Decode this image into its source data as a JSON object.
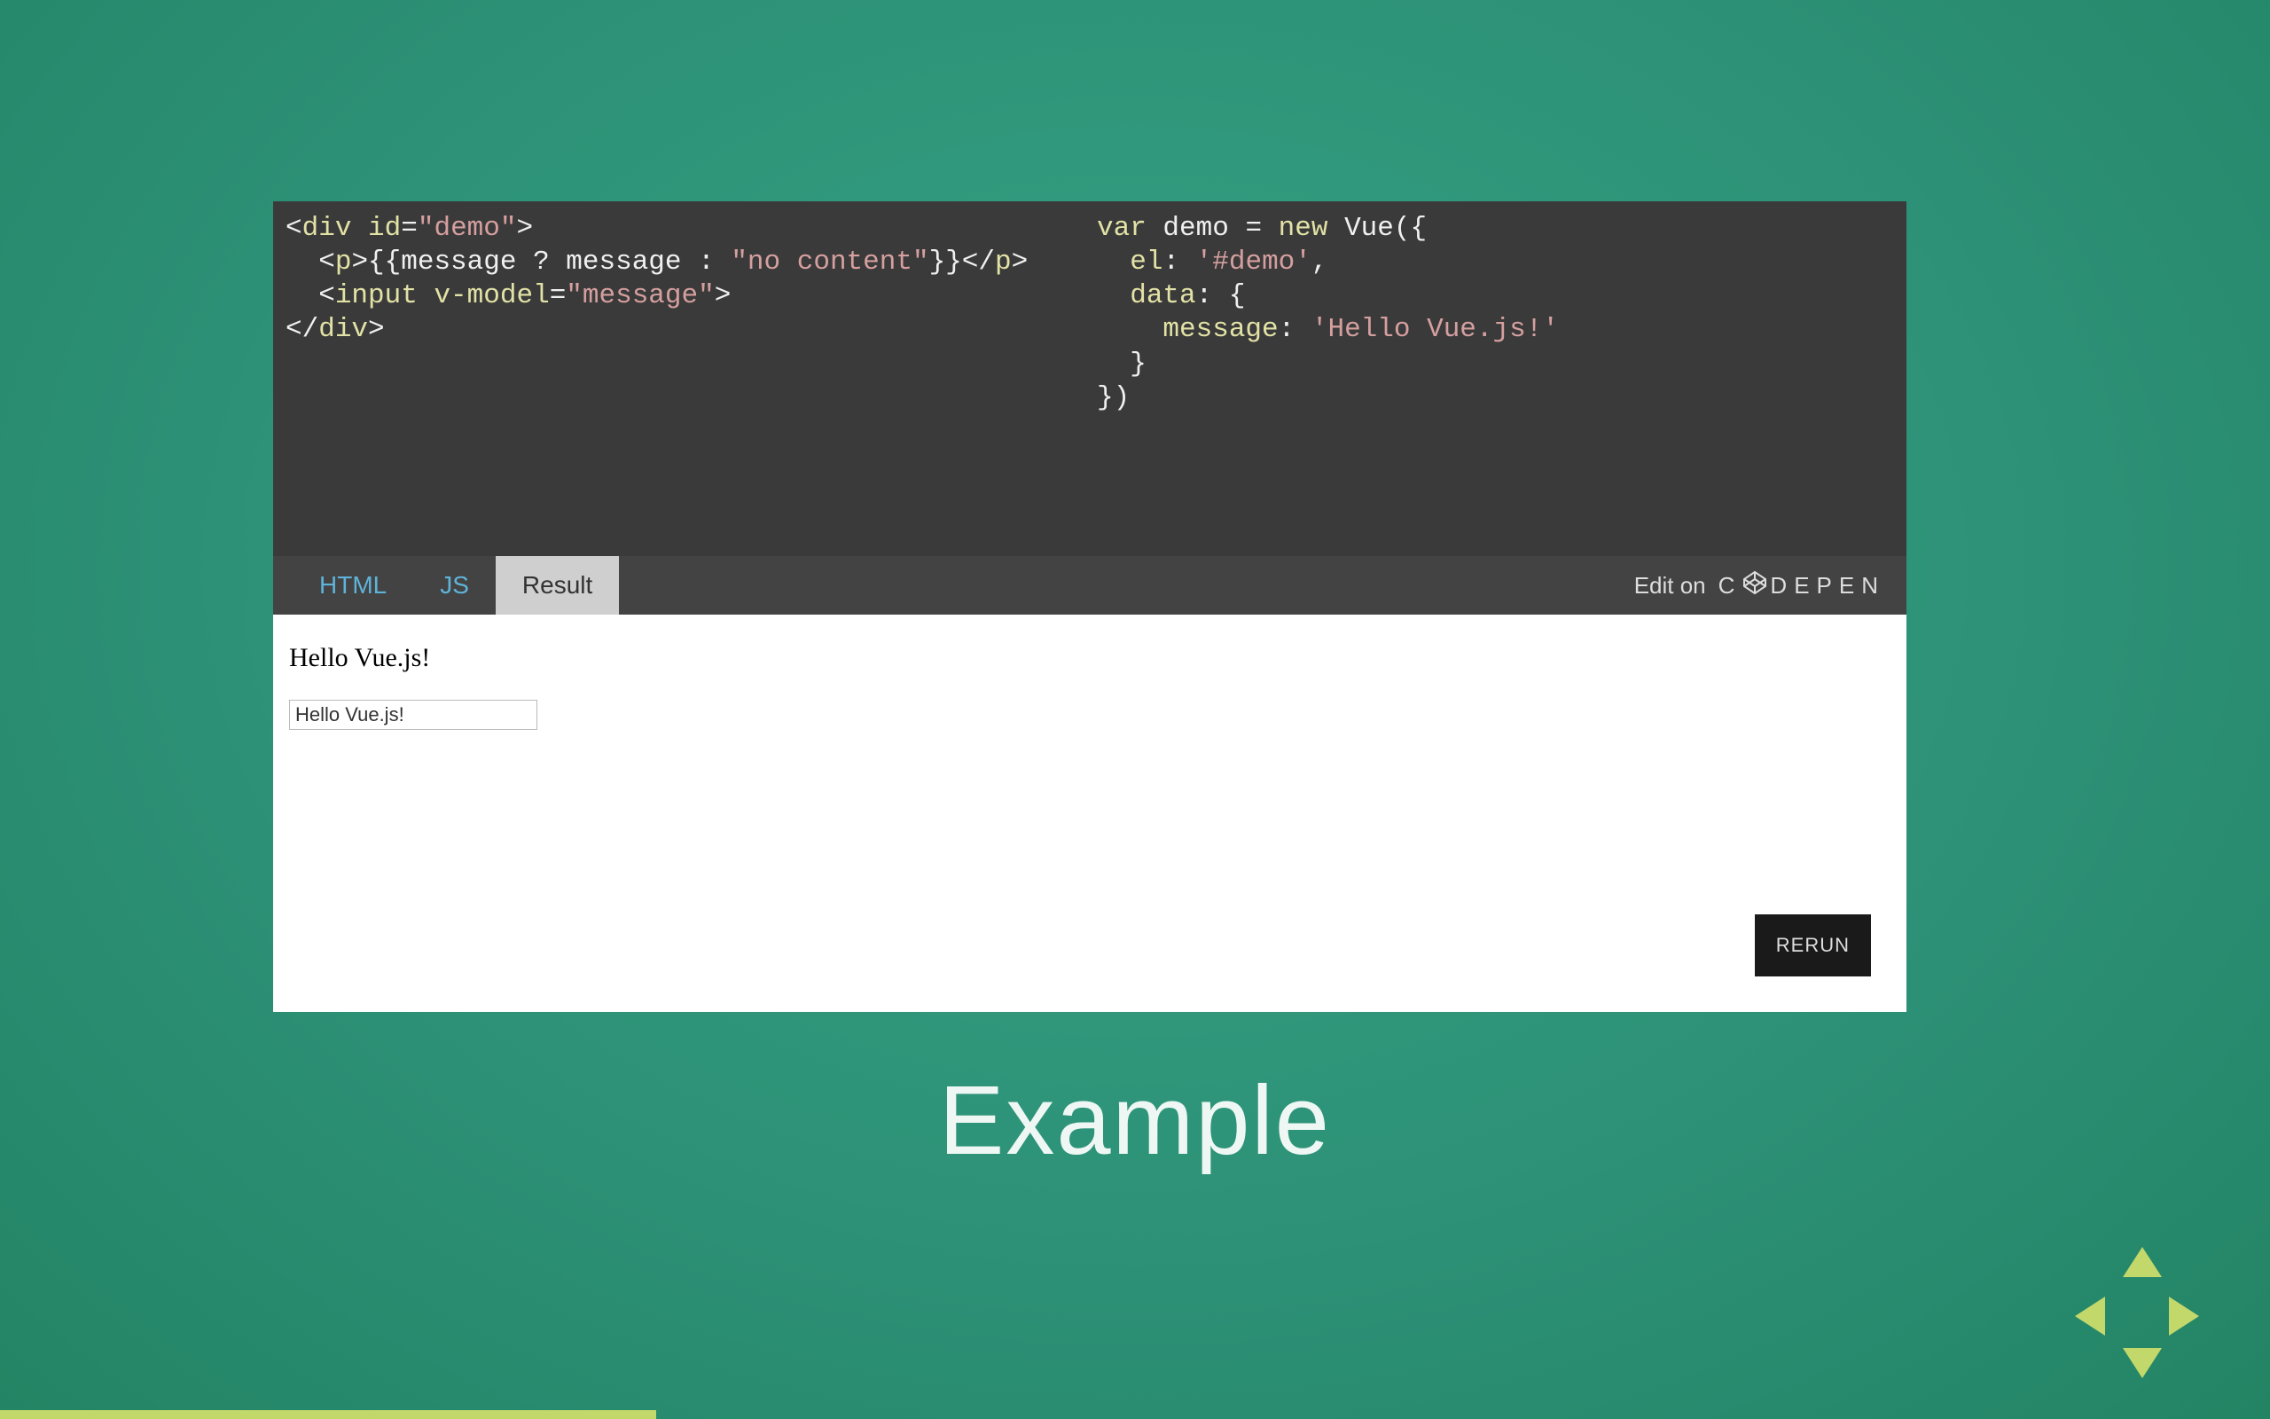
{
  "caption": "Example",
  "tabs": {
    "html": "HTML",
    "js": "JS",
    "result": "Result"
  },
  "edit_on_label": "Edit on",
  "codepen_brand": "C DEPEN",
  "rerun_label": "RERUN",
  "result": {
    "output_text": "Hello Vue.js!",
    "input_value": "Hello Vue.js!"
  },
  "code_html": {
    "l1": {
      "a": "<",
      "b": "div",
      "c": " ",
      "d": "id",
      "e": "=",
      "f": "\"demo\"",
      "g": ">"
    },
    "l2": {
      "a": "  ",
      "b": "<",
      "c": "p",
      "d": ">",
      "e": "{{message ? message : ",
      "f": "\"no content\"",
      "g": "}}",
      "h": "</",
      "i": "p",
      "j": ">"
    },
    "l3": {
      "a": "  ",
      "b": "<",
      "c": "input",
      "d": " ",
      "e": "v-model",
      "f": "=",
      "g": "\"message\"",
      "h": ">"
    },
    "l4": {
      "a": "</",
      "b": "div",
      "c": ">"
    }
  },
  "code_js": {
    "l1": {
      "a": "var",
      "b": " demo ",
      "c": "=",
      "d": " ",
      "e": "new",
      "f": " Vue",
      "g": "({"
    },
    "l2": {
      "a": "  ",
      "b": "el",
      "c": ": ",
      "d": "'#demo'",
      "e": ","
    },
    "l3": {
      "a": "  ",
      "b": "data",
      "c": ": {"
    },
    "l4": {
      "a": "    ",
      "b": "message",
      "c": ": ",
      "d": "'Hello Vue.js!'"
    },
    "l5": {
      "a": "  }"
    },
    "l6": {
      "a": "})"
    }
  },
  "colors": {
    "background": "#2e9578",
    "panel": "#3a3a3a",
    "tabbar": "#434343",
    "active_tab": "#cfcfcf",
    "link": "#5fb3d9",
    "accent": "#c3d86b"
  }
}
